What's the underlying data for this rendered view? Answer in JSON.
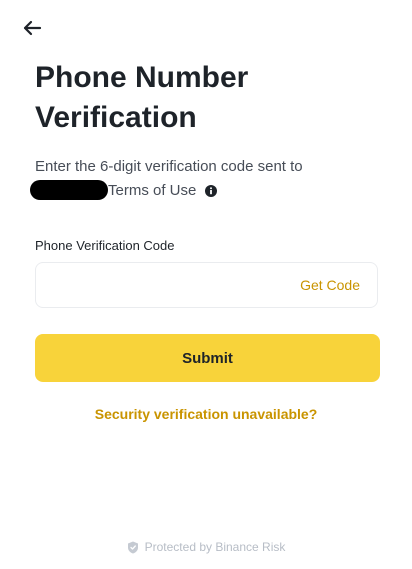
{
  "header": {
    "back_icon": "arrow-left-icon"
  },
  "title": {
    "line1": "Phone Number",
    "line2": "Verification"
  },
  "description": {
    "text": "Enter the 6-digit verification code sent to",
    "terms_link": "Terms of Use",
    "info_icon": "info-icon"
  },
  "form": {
    "label": "Phone Verification Code",
    "input_value": "",
    "get_code_label": "Get Code",
    "submit_label": "Submit"
  },
  "security_link": "Security verification unavailable?",
  "footer": {
    "icon": "shield-icon",
    "text": "Protected by Binance Risk"
  },
  "colors": {
    "accent": "#f8d33a",
    "link": "#c99400",
    "text": "#1e2329",
    "muted": "#474d57",
    "footer": "#b7bdc6"
  }
}
